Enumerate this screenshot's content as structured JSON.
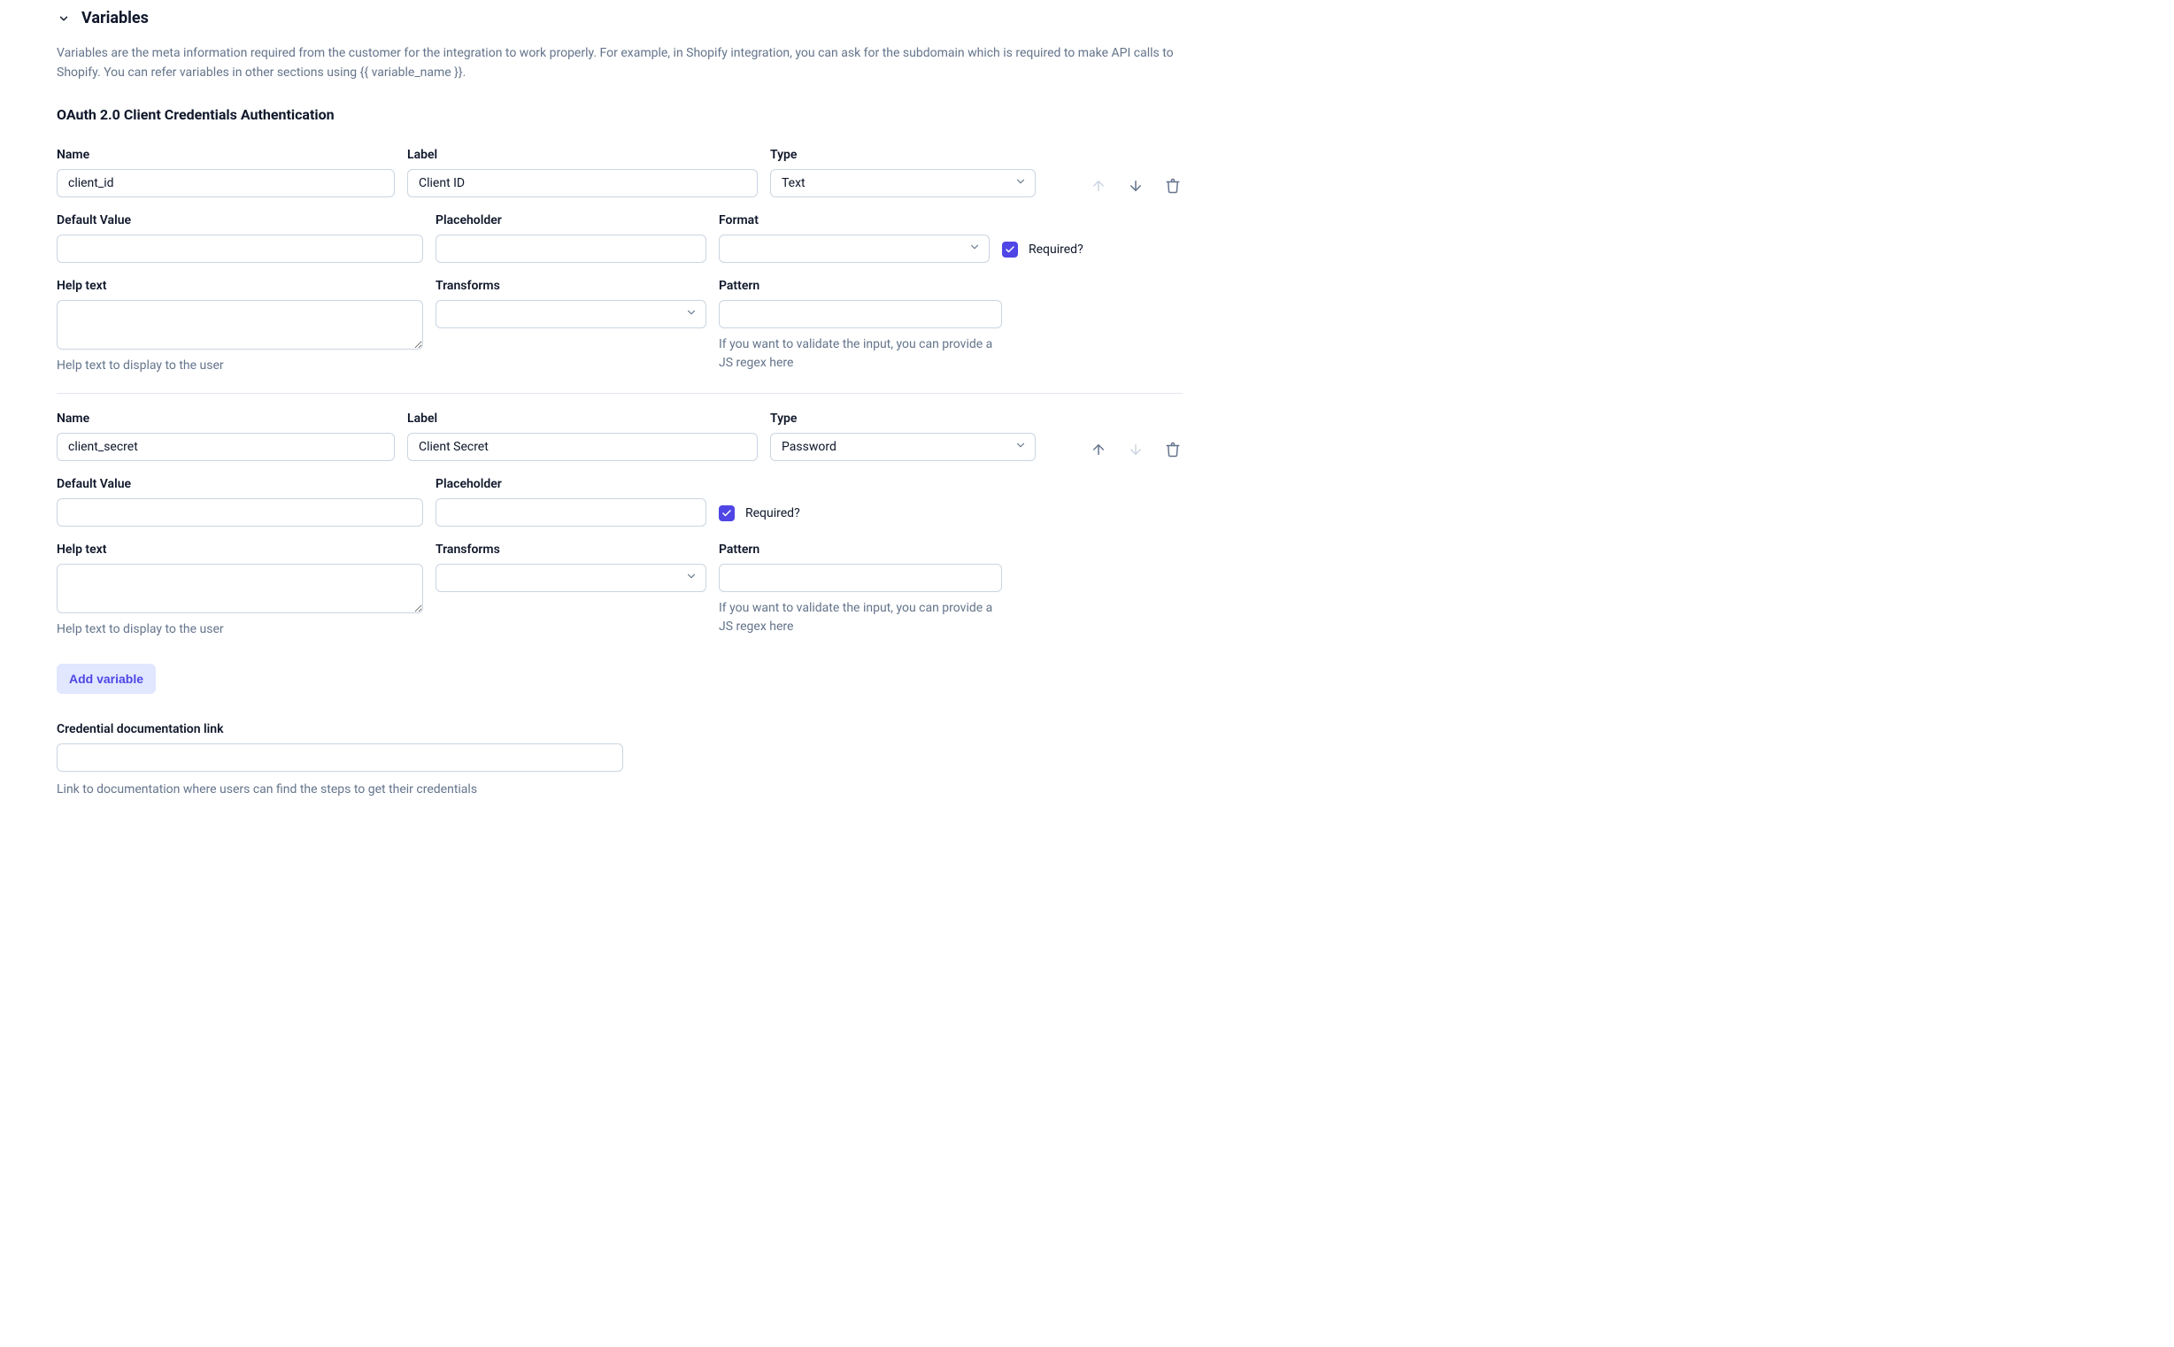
{
  "section": {
    "title": "Variables",
    "description": "Variables are the meta information required from the customer for the integration to work properly. For example, in Shopify integration, you can ask for the subdomain which is required to make API calls to Shopify. You can refer variables in other sections using {{ variable_name }}.",
    "subtitle": "OAuth 2.0 Client Credentials Authentication"
  },
  "labels": {
    "name": "Name",
    "label": "Label",
    "type": "Type",
    "default_value": "Default Value",
    "placeholder": "Placeholder",
    "format": "Format",
    "required": "Required?",
    "help_text": "Help text",
    "transforms": "Transforms",
    "pattern": "Pattern",
    "help_text_note": "Help text to display to the user",
    "pattern_note": "If you want to validate the input, you can provide a JS regex here",
    "add_variable": "Add variable",
    "cred_link": "Credential documentation link",
    "cred_link_note": "Link to documentation where users can find the steps to get their credentials"
  },
  "variables": [
    {
      "name": "client_id",
      "label": "Client ID",
      "type": "Text",
      "default_value": "",
      "placeholder": "",
      "format": "",
      "required": true,
      "help_text": "",
      "transforms": "",
      "pattern": "",
      "has_format": true,
      "up_enabled": false,
      "down_enabled": true
    },
    {
      "name": "client_secret",
      "label": "Client Secret",
      "type": "Password",
      "default_value": "",
      "placeholder": "",
      "format": "",
      "required": true,
      "help_text": "",
      "transforms": "",
      "pattern": "",
      "has_format": false,
      "up_enabled": true,
      "down_enabled": false
    }
  ],
  "cred_link_value": ""
}
